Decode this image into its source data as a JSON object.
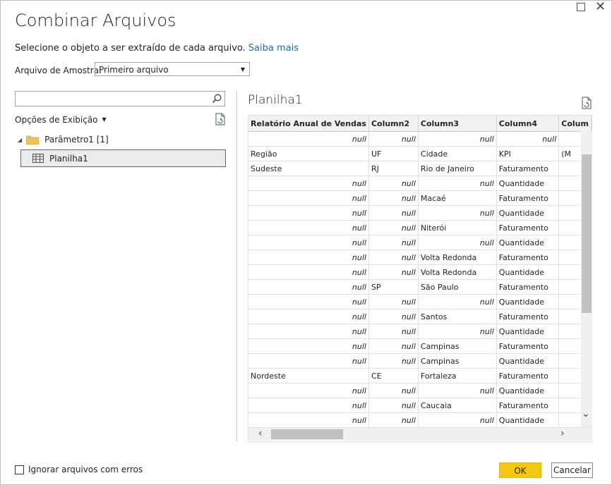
{
  "dialog": {
    "title": "Combinar Arquivos",
    "subtitle": "Selecione o objeto a ser extraído de cada arquivo.",
    "learn_more": "Saiba mais",
    "sample_label": "Arquivo de Amostra:",
    "sample_value": "Primeiro arquivo"
  },
  "left": {
    "search_placeholder": "",
    "display_options": "Opções de Exibição",
    "tree": {
      "parameter": "Parâmetro1 [1]",
      "sheet": "Planilha1"
    }
  },
  "preview": {
    "title": "Planilha1",
    "columns": [
      "Relatório Anual de Vendas",
      "Column2",
      "Column3",
      "Column4",
      "Colum"
    ],
    "rows": [
      [
        "null",
        "null",
        "null",
        "null",
        ""
      ],
      [
        "Região",
        "UF",
        "Cidade",
        "KPI",
        "(M"
      ],
      [
        "Sudeste",
        "RJ",
        "Rio de Janeiro",
        "Faturamento",
        ""
      ],
      [
        "null",
        "null",
        "null",
        "Quantidade",
        ""
      ],
      [
        "null",
        "null",
        "Macaé",
        "Faturamento",
        ""
      ],
      [
        "null",
        "null",
        "null",
        "Quantidade",
        ""
      ],
      [
        "null",
        "null",
        "Niterói",
        "Faturamento",
        ""
      ],
      [
        "null",
        "null",
        "null",
        "Quantidade",
        ""
      ],
      [
        "null",
        "null",
        "Volta Redonda",
        "Faturamento",
        ""
      ],
      [
        "null",
        "null",
        "Volta Redonda",
        "Quantidade",
        ""
      ],
      [
        "null",
        "SP",
        "São Paulo",
        "Faturamento",
        ""
      ],
      [
        "null",
        "null",
        "null",
        "Quantidade",
        ""
      ],
      [
        "null",
        "null",
        "Santos",
        "Faturamento",
        ""
      ],
      [
        "null",
        "null",
        "null",
        "Quantidade",
        ""
      ],
      [
        "null",
        "null",
        "Campinas",
        "Faturamento",
        ""
      ],
      [
        "null",
        "null",
        "Campinas",
        "Quantidade",
        ""
      ],
      [
        "Nordeste",
        "CE",
        "Fortaleza",
        "Faturamento",
        ""
      ],
      [
        "null",
        "null",
        "null",
        "Quantidade",
        ""
      ],
      [
        "null",
        "null",
        "Caucaia",
        "Faturamento",
        ""
      ],
      [
        "null",
        "null",
        "null",
        "Quantidade",
        ""
      ]
    ]
  },
  "footer": {
    "ignore_errors": "Ignorar arquivos com erros",
    "ok": "OK",
    "cancel": "Cancelar"
  },
  "colors": {
    "accent": "#f2c811",
    "link": "#1a6fb0"
  }
}
